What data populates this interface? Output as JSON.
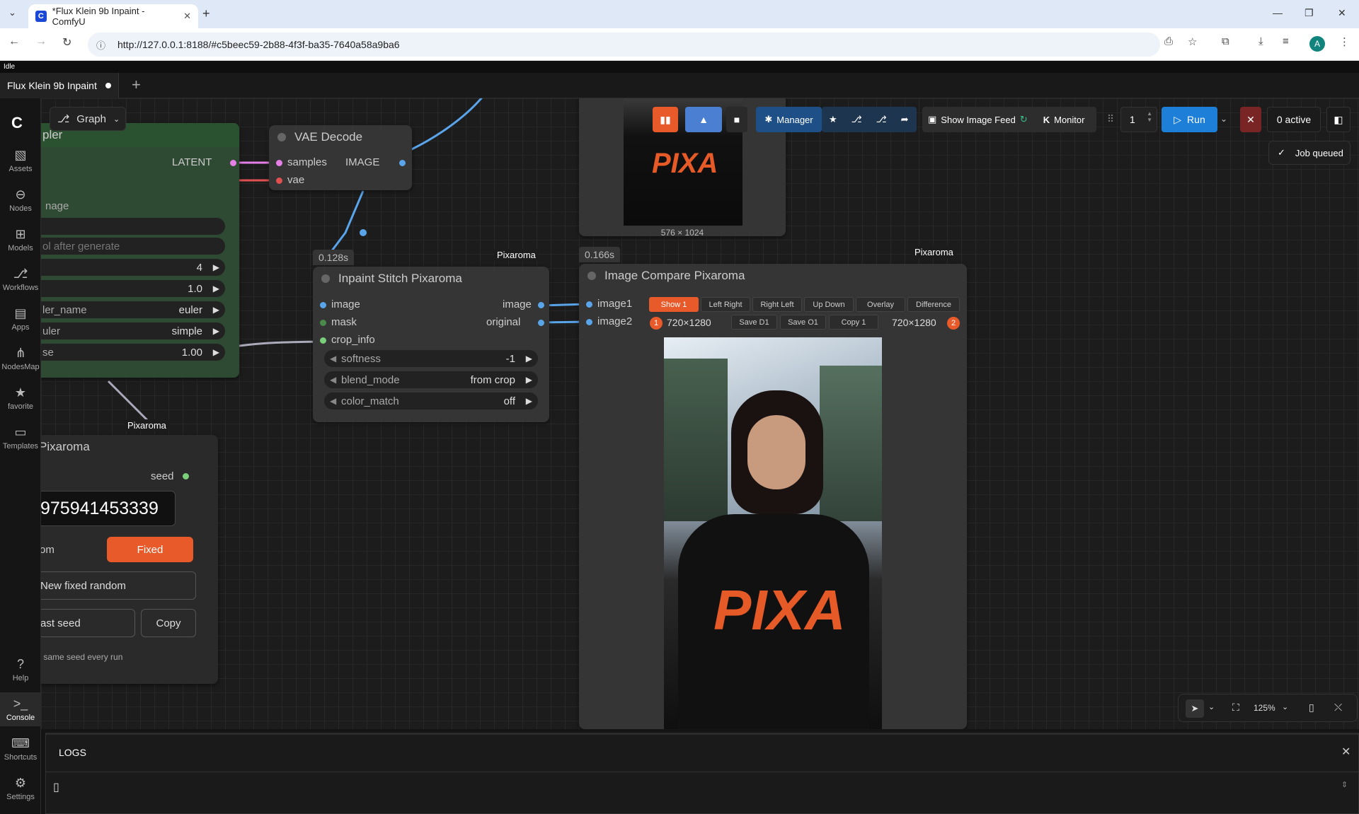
{
  "browser": {
    "tab_title": "*Flux Klein 9b Inpaint - ComfyU",
    "url": "http://127.0.0.1:8188/#c5beec59-2b88-4f3f-ba35-7640a58a9ba6",
    "avatar": "A"
  },
  "status": "Idle",
  "workflow_tab": {
    "label": "Flux Klein 9b Inpaint",
    "add": "+"
  },
  "graph_menu": {
    "label": "Graph"
  },
  "sidebar": {
    "items": [
      {
        "label": "Assets",
        "icon": "assets-icon"
      },
      {
        "label": "Nodes",
        "icon": "nodes-icon"
      },
      {
        "label": "Models",
        "icon": "models-icon"
      },
      {
        "label": "Workflows",
        "icon": "workflows-icon"
      },
      {
        "label": "Apps",
        "icon": "apps-icon"
      },
      {
        "label": "NodesMap",
        "icon": "nodesmap-icon"
      },
      {
        "label": "favorite",
        "icon": "star-icon"
      },
      {
        "label": "Templates",
        "icon": "templates-icon"
      },
      {
        "label": "Help",
        "icon": "help-icon"
      },
      {
        "label": "Console",
        "icon": "console-icon"
      },
      {
        "label": "Shortcuts",
        "icon": "keyboard-icon"
      },
      {
        "label": "Settings",
        "icon": "gear-icon"
      }
    ]
  },
  "toolbar": {
    "manager": "Manager",
    "show_image_feed": "Show Image Feed",
    "monitor": "Monitor",
    "queue_count": "1",
    "run": "Run",
    "active": "0 active",
    "job_queued": "Job queued"
  },
  "sampler_node": {
    "title": "pler",
    "latent": "LATENT",
    "image_label": "nage",
    "ph_empty": "",
    "after_generate": "ol after generate",
    "steps": "4",
    "cfg": "1.0",
    "sampler_name_label": "ler_name",
    "sampler_name": "euler",
    "scheduler_label": "uler",
    "scheduler": "simple",
    "denoise_label": "se",
    "denoise": "1.00"
  },
  "vae_decode": {
    "title": "VAE Decode",
    "samples": "samples",
    "vae": "vae",
    "image": "IMAGE"
  },
  "inpaint_stitch": {
    "title": "Inpaint Stitch Pixaroma",
    "time": "0.128s",
    "tag": "Pixaroma",
    "in_image": "image",
    "in_mask": "mask",
    "in_crop": "crop_info",
    "out_image": "image",
    "out_original": "original",
    "softness_label": "softness",
    "softness": "-1",
    "blend_label": "blend_mode",
    "blend": "from crop",
    "color_label": "color_match",
    "color": "off"
  },
  "preview_node": {
    "size": "576 × 1024",
    "shirt_text": "PIXA"
  },
  "image_compare": {
    "title": "Image Compare Pixaroma",
    "time": "0.166s",
    "tag": "Pixaroma",
    "in1": "image1",
    "in2": "image2",
    "modes": [
      "Show 1",
      "Left Right",
      "Right Left",
      "Up Down",
      "Overlay",
      "Difference"
    ],
    "badge1": "1",
    "size1": "720×1280",
    "save_d1": "Save D1",
    "save_o1": "Save O1",
    "copy1": "Copy 1",
    "size2": "720×1280",
    "badge2": "2",
    "shirt_text": "PIXA"
  },
  "seed_node": {
    "tag": "Pixaroma",
    "title": "Pixaroma",
    "seed_label": "seed",
    "seed_value": "975941453339",
    "random": "om",
    "fixed": "Fixed",
    "new_fixed": "New fixed random",
    "last_seed": "ast seed",
    "copy": "Copy",
    "hint": "d: same seed every run"
  },
  "canvas_controls": {
    "zoom": "125%"
  },
  "logs": {
    "title": "LOGS",
    "cursor": "▯"
  }
}
